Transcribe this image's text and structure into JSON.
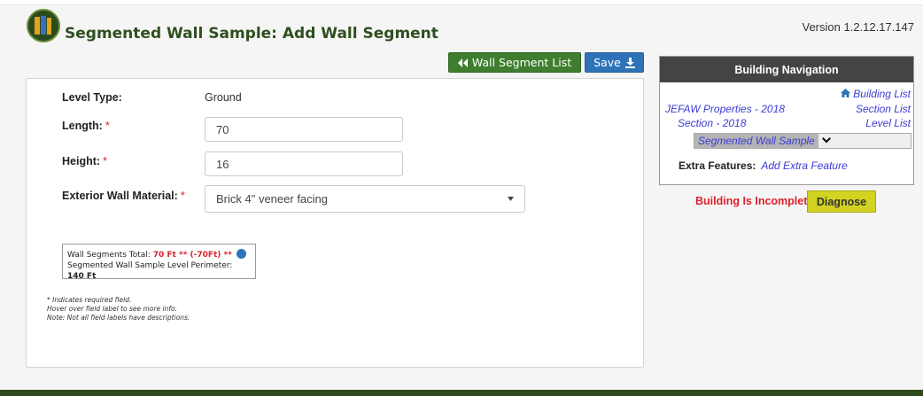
{
  "header": {
    "title": "Segmented Wall Sample: Add Wall Segment",
    "version": "Version 1.2.12.17.147",
    "logo_icon": "books-logo-icon"
  },
  "toolbar": {
    "list_label": "Wall Segment List",
    "list_icon": "double-chevron-left-icon",
    "save_label": "Save",
    "save_icon": "download-icon"
  },
  "form": {
    "level_type_label": "Level Type:",
    "level_type_value": "Ground",
    "length_label": "Length:",
    "length_value": "70",
    "height_label": "Height:",
    "height_value": "16",
    "material_label": "Exterior Wall Material:",
    "material_value": "Brick 4\" veneer facing",
    "required_mark": "*"
  },
  "totals": {
    "total_label": "Wall Segments Total:",
    "total_value": "70 Ft ** (-70Ft) **",
    "perimeter_label": "Segmented Wall Sample Level Perimeter:",
    "perimeter_value": "140 Ft"
  },
  "notes": {
    "required": "* Indicates required field.",
    "hover": "Hover over field label to see more info.",
    "note": "Note: Not all field labels have descriptions."
  },
  "navigation": {
    "title": "Building Navigation",
    "building_list": "Building List",
    "property": "JEFAW Properties - 2018",
    "section_list": "Section List",
    "section": "Section - 2018",
    "level_list": "Level List",
    "current_level": "Segmented Wall Sample",
    "extra_label": "Extra Features:",
    "extra_link": "Add Extra Feature"
  },
  "status": {
    "message": "Building Is Incomplete",
    "diagnose_label": "Diagnose"
  },
  "colors": {
    "brand_green": "#2f4f1f",
    "button_green": "#3f7e2f",
    "button_blue": "#2e73b8",
    "required_red": "#d9232d",
    "link_blue": "#3b3bd6",
    "diagnose_yellow": "#d2d321"
  }
}
